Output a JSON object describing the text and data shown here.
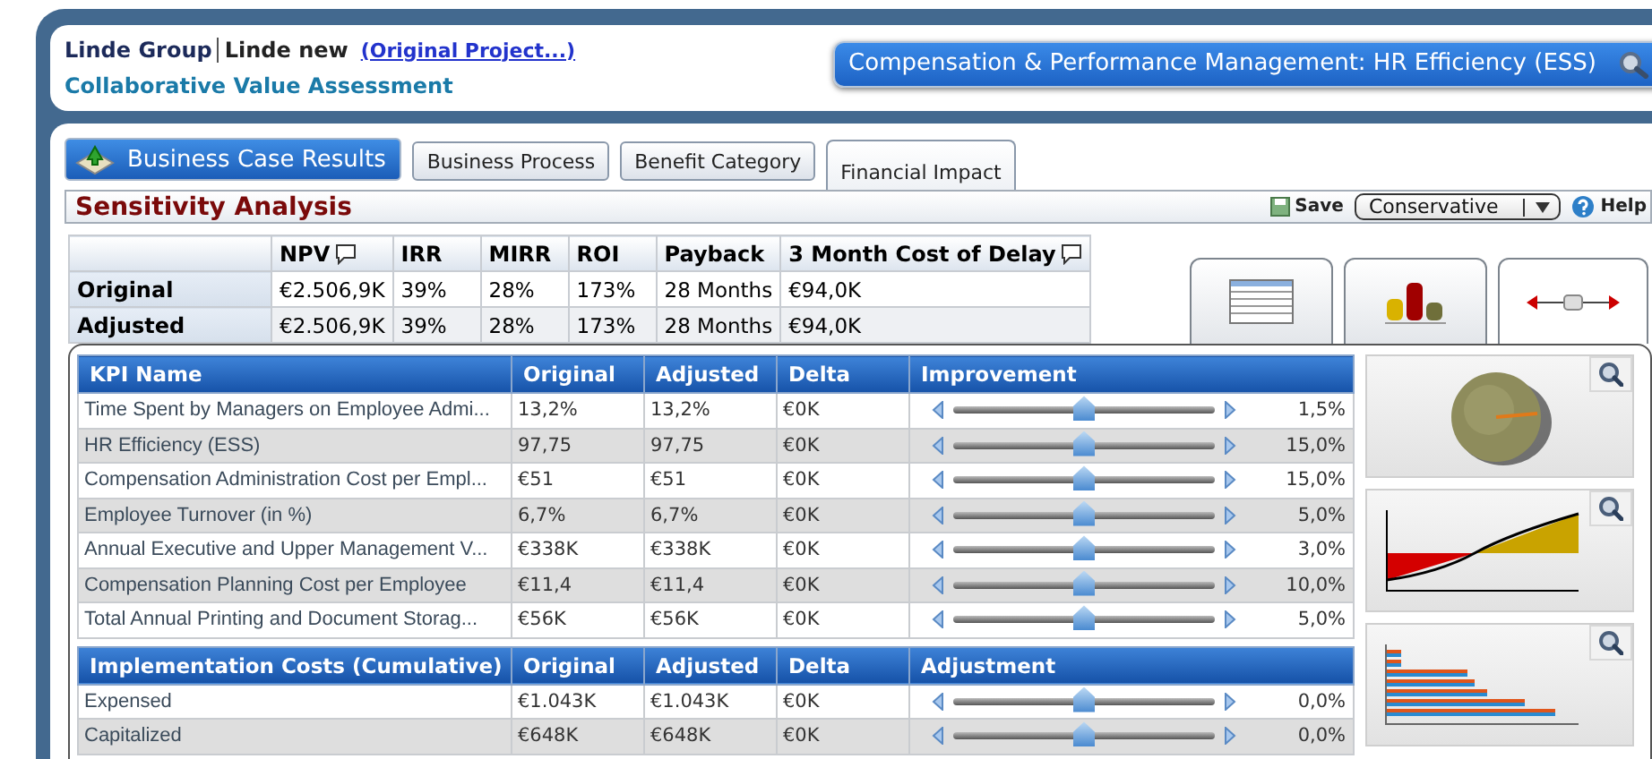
{
  "header": {
    "company": "Linde Group",
    "project": "Linde new",
    "project_link": "(Original Project...)",
    "subtitle": "Collaborative Value Assessment",
    "selection": "Compensation & Performance Management: HR Efficiency (ESS)"
  },
  "main_button": "Business Case Results",
  "tabs": [
    {
      "label": "Business Process",
      "selected": false
    },
    {
      "label": "Benefit Category",
      "selected": false
    },
    {
      "label": "Financial Impact",
      "selected": true
    }
  ],
  "section": {
    "title": "Sensitivity Analysis",
    "save": "Save",
    "scenario": "Conservative",
    "help": "Help"
  },
  "summary": {
    "columns": [
      {
        "label": "NPV",
        "info": true
      },
      {
        "label": "IRR",
        "info": false
      },
      {
        "label": "MIRR",
        "info": false
      },
      {
        "label": "ROI",
        "info": false
      },
      {
        "label": "Payback",
        "info": false
      },
      {
        "label": "3 Month Cost of Delay",
        "info": true
      }
    ],
    "rows": [
      {
        "label": "Original",
        "cells": [
          "€2.506,9K",
          "39%",
          "28%",
          "173%",
          "28 Months",
          "€94,0K"
        ]
      },
      {
        "label": "Adjusted",
        "cells": [
          "€2.506,9K",
          "39%",
          "28%",
          "173%",
          "28 Months",
          "€94,0K"
        ]
      }
    ]
  },
  "views": [
    {
      "kind": "table",
      "selected": false
    },
    {
      "kind": "bar",
      "selected": false
    },
    {
      "kind": "slider",
      "selected": true
    }
  ],
  "kpi_table": {
    "columns": [
      "KPI Name",
      "Original",
      "Adjusted",
      "Delta",
      "Improvement"
    ],
    "rows": [
      {
        "name": "Time Spent by Managers on Employee Admi...",
        "original": "13,2%",
        "adjusted": "13,2%",
        "delta": "€0K",
        "level": 0.5,
        "reading": "1,5%"
      },
      {
        "name": "HR Efficiency (ESS)",
        "original": "97,75",
        "adjusted": "97,75",
        "delta": "€0K",
        "level": 0.5,
        "reading": "15,0%"
      },
      {
        "name": "Compensation Administration Cost per Empl...",
        "original": "€51",
        "adjusted": "€51",
        "delta": "€0K",
        "level": 0.5,
        "reading": "15,0%"
      },
      {
        "name": "Employee Turnover (in %)",
        "original": "6,7%",
        "adjusted": "6,7%",
        "delta": "€0K",
        "level": 0.5,
        "reading": "5,0%"
      },
      {
        "name": "Annual Executive and Upper Management V...",
        "original": "€338K",
        "adjusted": "€338K",
        "delta": "€0K",
        "level": 0.5,
        "reading": "3,0%"
      },
      {
        "name": "Compensation Planning Cost per Employee",
        "original": "€11,4",
        "adjusted": "€11,4",
        "delta": "€0K",
        "level": 0.5,
        "reading": "10,0%"
      },
      {
        "name": "Total Annual Printing and Document Storag...",
        "original": "€56K",
        "adjusted": "€56K",
        "delta": "€0K",
        "level": 0.5,
        "reading": "5,0%"
      }
    ]
  },
  "cost_table": {
    "columns": [
      "Implementation Costs (Cumulative)",
      "Original",
      "Adjusted",
      "Delta",
      "Adjustment"
    ],
    "rows": [
      {
        "name": "Expensed",
        "original": "€1.043K",
        "adjusted": "€1.043K",
        "delta": "€0K",
        "level": 0.5,
        "reading": "0,0%"
      },
      {
        "name": "Capitalized",
        "original": "€648K",
        "adjusted": "€648K",
        "delta": "€0K",
        "level": 0.5,
        "reading": "0,0%"
      }
    ]
  },
  "side_charts": [
    {
      "kind": "pie"
    },
    {
      "kind": "area"
    },
    {
      "kind": "bars"
    }
  ]
}
